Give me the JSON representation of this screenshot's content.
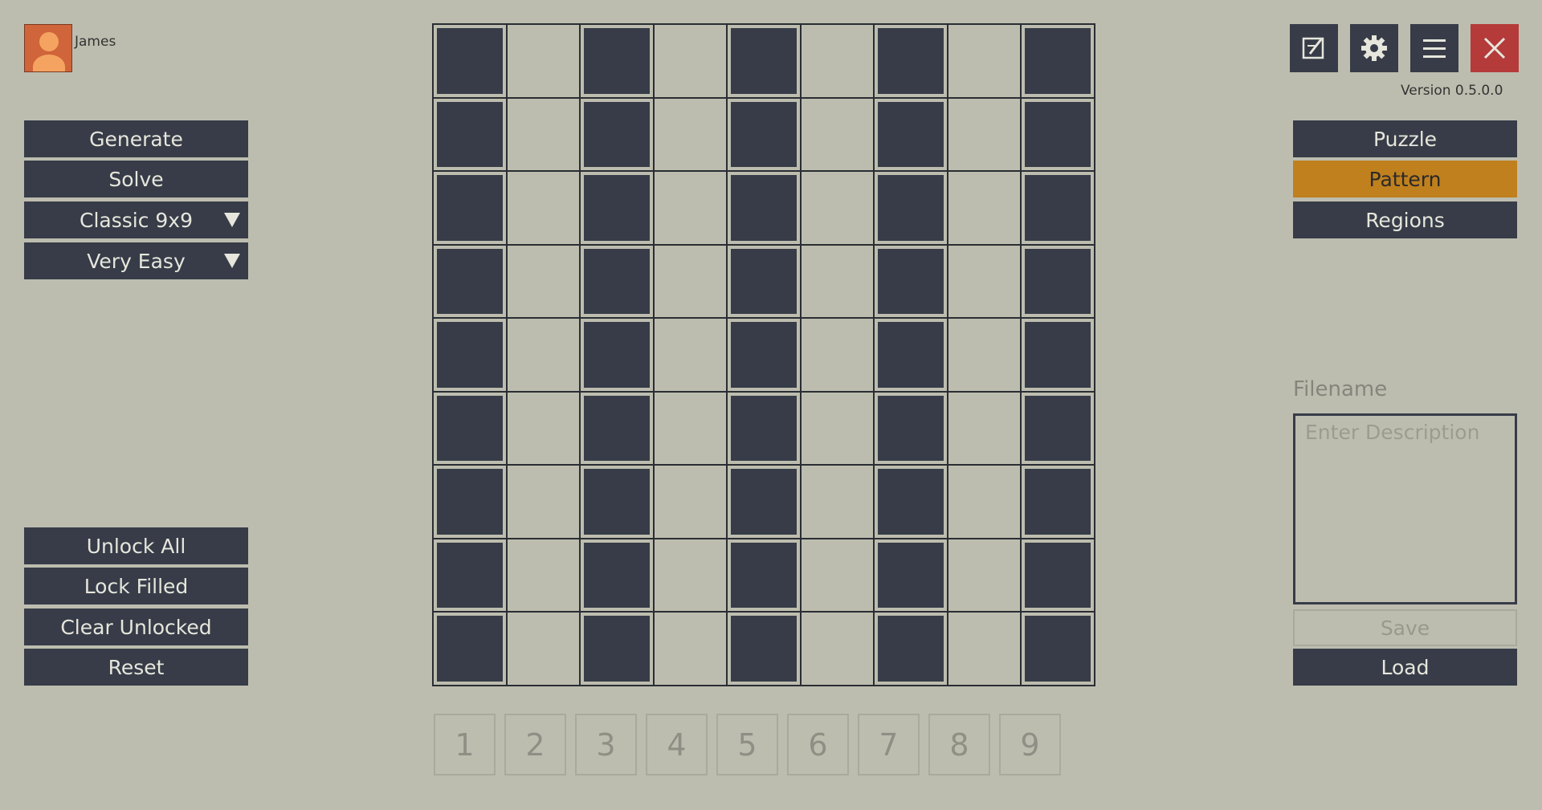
{
  "user": {
    "name": "James"
  },
  "version": "Version 0.5.0.0",
  "left_menu": {
    "generate": "Generate",
    "solve": "Solve",
    "variant": "Classic 9x9",
    "difficulty": "Very Easy",
    "unlock_all": "Unlock All",
    "lock_filled": "Lock Filled",
    "clear_unlocked": "Clear Unlocked",
    "reset": "Reset"
  },
  "modes": {
    "puzzle": "Puzzle",
    "pattern": "Pattern",
    "regions": "Regions",
    "active": "Pattern"
  },
  "toolbar": {
    "icons": [
      "edit-icon",
      "gear-icon",
      "menu-icon",
      "close-icon"
    ]
  },
  "file": {
    "label": "Filename",
    "placeholder": "Enter Description",
    "save": "Save",
    "load": "Load"
  },
  "numpad": [
    "1",
    "2",
    "3",
    "4",
    "5",
    "6",
    "7",
    "8",
    "9"
  ],
  "board": {
    "rows": [
      [
        1,
        0,
        1,
        0,
        1,
        0,
        1,
        0,
        1
      ],
      [
        1,
        0,
        1,
        0,
        1,
        0,
        1,
        0,
        1
      ],
      [
        1,
        0,
        1,
        0,
        1,
        0,
        1,
        0,
        1
      ],
      [
        1,
        0,
        1,
        0,
        1,
        0,
        1,
        0,
        1
      ],
      [
        1,
        0,
        1,
        0,
        1,
        0,
        1,
        0,
        1
      ],
      [
        1,
        0,
        1,
        0,
        1,
        0,
        1,
        0,
        1
      ],
      [
        1,
        0,
        1,
        0,
        1,
        0,
        1,
        0,
        1
      ],
      [
        1,
        0,
        1,
        0,
        1,
        0,
        1,
        0,
        1
      ],
      [
        1,
        0,
        1,
        0,
        1,
        0,
        1,
        0,
        1
      ]
    ]
  },
  "colors": {
    "background": "#bdbdaf",
    "button": "#373c48",
    "accent": "#c0801d",
    "close": "#b53a3a"
  }
}
